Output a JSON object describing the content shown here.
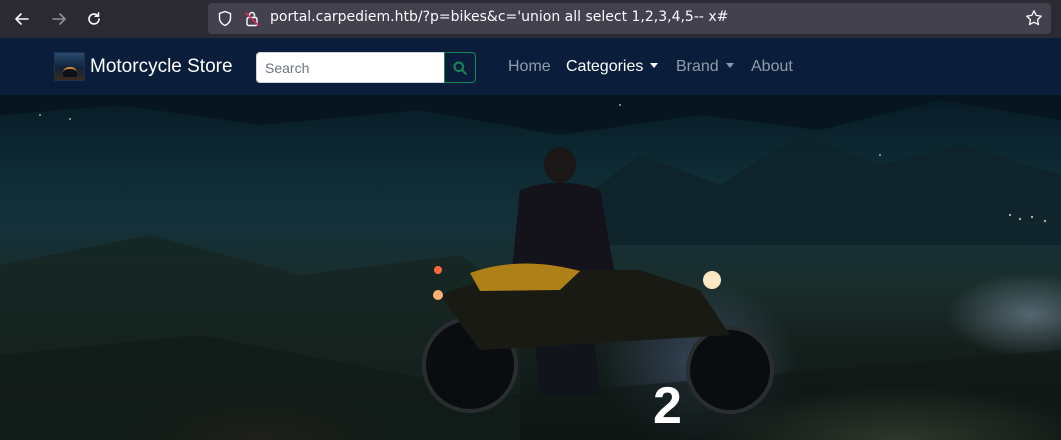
{
  "browser": {
    "url": "portal.carpediem.htb/?p=bikes&c='union all select 1,2,3,4,5-- x#"
  },
  "navbar": {
    "brand": "Motorcycle Store",
    "search_placeholder": "Search",
    "links": [
      {
        "label": "Home",
        "active": false,
        "dropdown": false
      },
      {
        "label": "Categories",
        "active": true,
        "dropdown": true
      },
      {
        "label": "Brand",
        "active": false,
        "dropdown": true
      },
      {
        "label": "About",
        "active": false,
        "dropdown": false
      }
    ]
  },
  "hero": {
    "number": "2"
  },
  "colors": {
    "navbar_bg": "#0a1e3c",
    "search_button": "#198754",
    "browser_bg": "#2b2a33",
    "urlbar_bg": "#42414d"
  }
}
